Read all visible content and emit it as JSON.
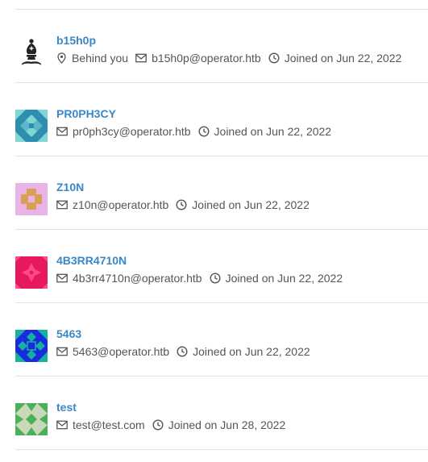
{
  "users": [
    {
      "name": "b15h0p",
      "avatar_icon": "chess-bishop-icon",
      "location": "Behind you",
      "email": "b15h0p@operator.htb",
      "joined": "Joined on Jun 22, 2022"
    },
    {
      "name": "PR0PH3CY",
      "avatar_icon": "identicon-teal",
      "avatar_colors": {
        "bg": "#2c8fb0",
        "fg": "#7fd6d2"
      },
      "email": "pr0ph3cy@operator.htb",
      "joined": "Joined on Jun 22, 2022"
    },
    {
      "name": "Z10N",
      "avatar_icon": "identicon-pink",
      "avatar_colors": {
        "bg": "#e8b4e8",
        "fg": "#d8a050"
      },
      "email": "z10n@operator.htb",
      "joined": "Joined on Jun 22, 2022"
    },
    {
      "name": "4B3RR4710N",
      "avatar_icon": "identicon-magenta",
      "avatar_colors": {
        "bg": "#e81860",
        "fg": "#ff4a8a"
      },
      "email": "4b3rr4710n@operator.htb",
      "joined": "Joined on Jun 22, 2022"
    },
    {
      "name": "5463",
      "avatar_icon": "identicon-blue",
      "avatar_colors": {
        "bg": "#1a2adf",
        "fg": "#16b0a0"
      },
      "email": "5463@operator.htb",
      "joined": "Joined on Jun 22, 2022"
    },
    {
      "name": "test",
      "avatar_icon": "identicon-green",
      "avatar_colors": {
        "bg": "#c8d8b8",
        "fg": "#4ab05a"
      },
      "email": "test@test.com",
      "joined": "Joined on Jun 28, 2022"
    }
  ]
}
